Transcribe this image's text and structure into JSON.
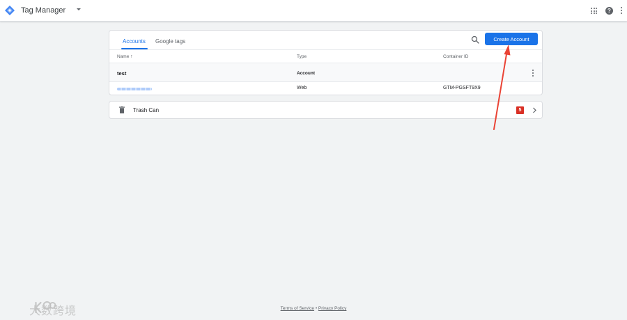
{
  "header": {
    "app_title": "Tag Manager",
    "help_glyph": "?",
    "icons": [
      "tag-manager-logo-icon",
      "dropdown-caret-icon",
      "apps-grid-icon",
      "help-icon",
      "more-vert-icon"
    ]
  },
  "tabs": [
    {
      "label": "Accounts",
      "active": true
    },
    {
      "label": "Google tags",
      "active": false
    }
  ],
  "toolbar": {
    "create_label": "Create Account",
    "search_icon": "search-icon"
  },
  "table": {
    "columns": [
      "Name",
      "Type",
      "Container ID"
    ],
    "sort_glyph": "↑",
    "rows": [
      {
        "name": "test",
        "type": "Account",
        "container_id": ""
      },
      {
        "name": "",
        "type": "Web",
        "container_id": "GTM-PGSFT9X9"
      }
    ]
  },
  "trash": {
    "label": "Trash Can",
    "count": "5"
  },
  "footer": {
    "terms": "Terms of Service",
    "separator": "•",
    "privacy": "Privacy Policy"
  },
  "watermark": {
    "text": "大数跨境"
  },
  "colors": {
    "accent": "#1a73e8",
    "badge": "#d93025",
    "annotation": "#ea4335"
  }
}
